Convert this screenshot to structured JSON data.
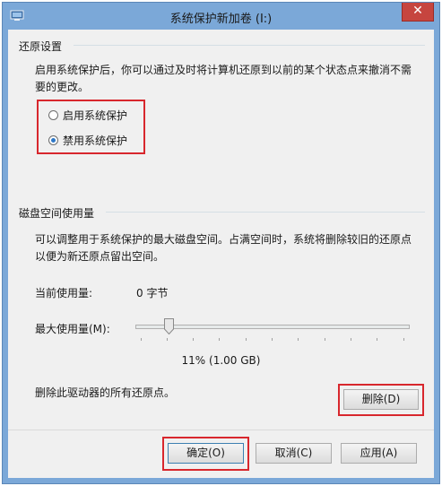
{
  "window": {
    "title": "系统保护新加卷 (I:)",
    "close_glyph": "✕"
  },
  "restore": {
    "group_label": "还原设置",
    "description": "启用系统保护后，你可以通过及时将计算机还原到以前的某个状态点来撤消不需要的更改。",
    "description_line1": "启用系统保护后，你可以通过及时将计算机还原到以前的某个状态点来撤消不需",
    "description_line2": "要的更改。",
    "options": [
      {
        "label": "启用系统保护",
        "checked": false
      },
      {
        "label": "禁用系统保护",
        "checked": true
      }
    ]
  },
  "disk": {
    "group_label": "磁盘空间使用量",
    "description_line1": "可以调整用于系统保护的最大磁盘空间。占满空间时，系统将删除较旧的还原点",
    "description_line2": "以便为新还原点留出空间。",
    "current_usage_label": "当前使用量:",
    "current_usage_value": "0 字节",
    "max_usage_label": "最大使用量(M):",
    "max_usage_fraction": 0.11,
    "max_usage_readout": "11% (1.00 GB)",
    "delete_description": "删除此驱动器的所有还原点。",
    "delete_button": "删除(D)"
  },
  "footer": {
    "ok": "确定(O)",
    "cancel": "取消(C)",
    "apply": "应用(A)"
  },
  "colors": {
    "highlight_box": "#d8272d",
    "title_bar": "#7ba8d8",
    "close_button": "#c6453f",
    "radio_checked": "#2e77c6"
  }
}
